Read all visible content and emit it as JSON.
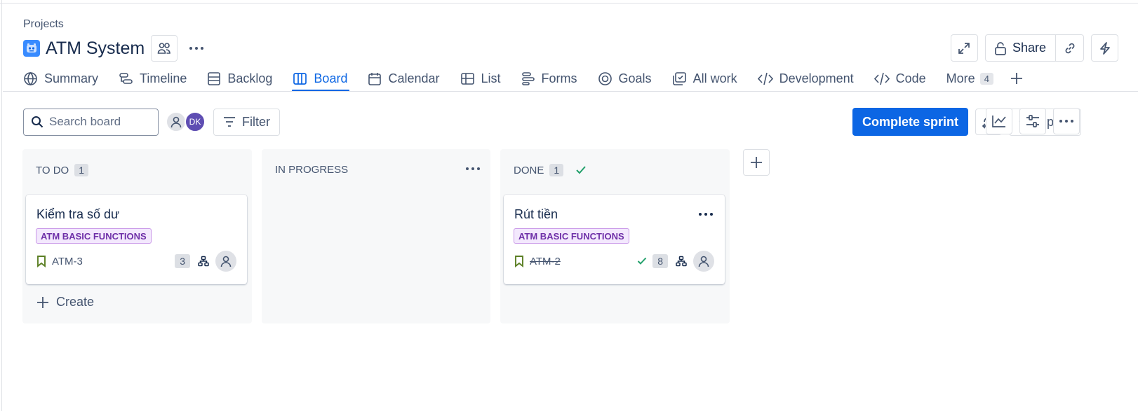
{
  "breadcrumb": "Projects",
  "project": {
    "title": "ATM System",
    "icon": "project-robot-icon",
    "icon_color": "#388bff"
  },
  "header_actions": {
    "share_label": "Share"
  },
  "tabs": [
    {
      "label": "Summary",
      "icon": "globe-icon"
    },
    {
      "label": "Timeline",
      "icon": "timeline-icon"
    },
    {
      "label": "Backlog",
      "icon": "backlog-icon"
    },
    {
      "label": "Board",
      "icon": "board-icon",
      "active": true
    },
    {
      "label": "Calendar",
      "icon": "calendar-icon"
    },
    {
      "label": "List",
      "icon": "list-icon"
    },
    {
      "label": "Forms",
      "icon": "forms-icon"
    },
    {
      "label": "Goals",
      "icon": "goals-icon"
    },
    {
      "label": "All work",
      "icon": "all-work-icon"
    },
    {
      "label": "Development",
      "icon": "development-icon"
    },
    {
      "label": "Code",
      "icon": "code-icon"
    }
  ],
  "more_tab": {
    "label": "More",
    "count": "4"
  },
  "toolbar": {
    "search_placeholder": "Search board",
    "avatar_initials": "DK",
    "filter_label": "Filter",
    "complete_label": "Complete sprint",
    "group_label": "Group"
  },
  "colors": {
    "accent": "#0c66e4",
    "epic_bg": "#f3e8fd",
    "epic_text": "#6e2fa8",
    "done_green": "#22a06b",
    "story_green": "#5b7f24",
    "avatar_dk": "#5e4db2"
  },
  "columns": [
    {
      "title": "TO DO",
      "count": "1",
      "create_label": "Create",
      "card": {
        "title": "Kiểm tra số dư",
        "epic": "ATM BASIC FUNCTIONS",
        "key": "ATM-3",
        "estimate": "3"
      }
    },
    {
      "title": "IN PROGRESS"
    },
    {
      "title": "DONE",
      "count": "1",
      "card": {
        "title": "Rút tiền",
        "epic": "ATM BASIC FUNCTIONS",
        "key": "ATM-2",
        "estimate": "8"
      }
    }
  ]
}
